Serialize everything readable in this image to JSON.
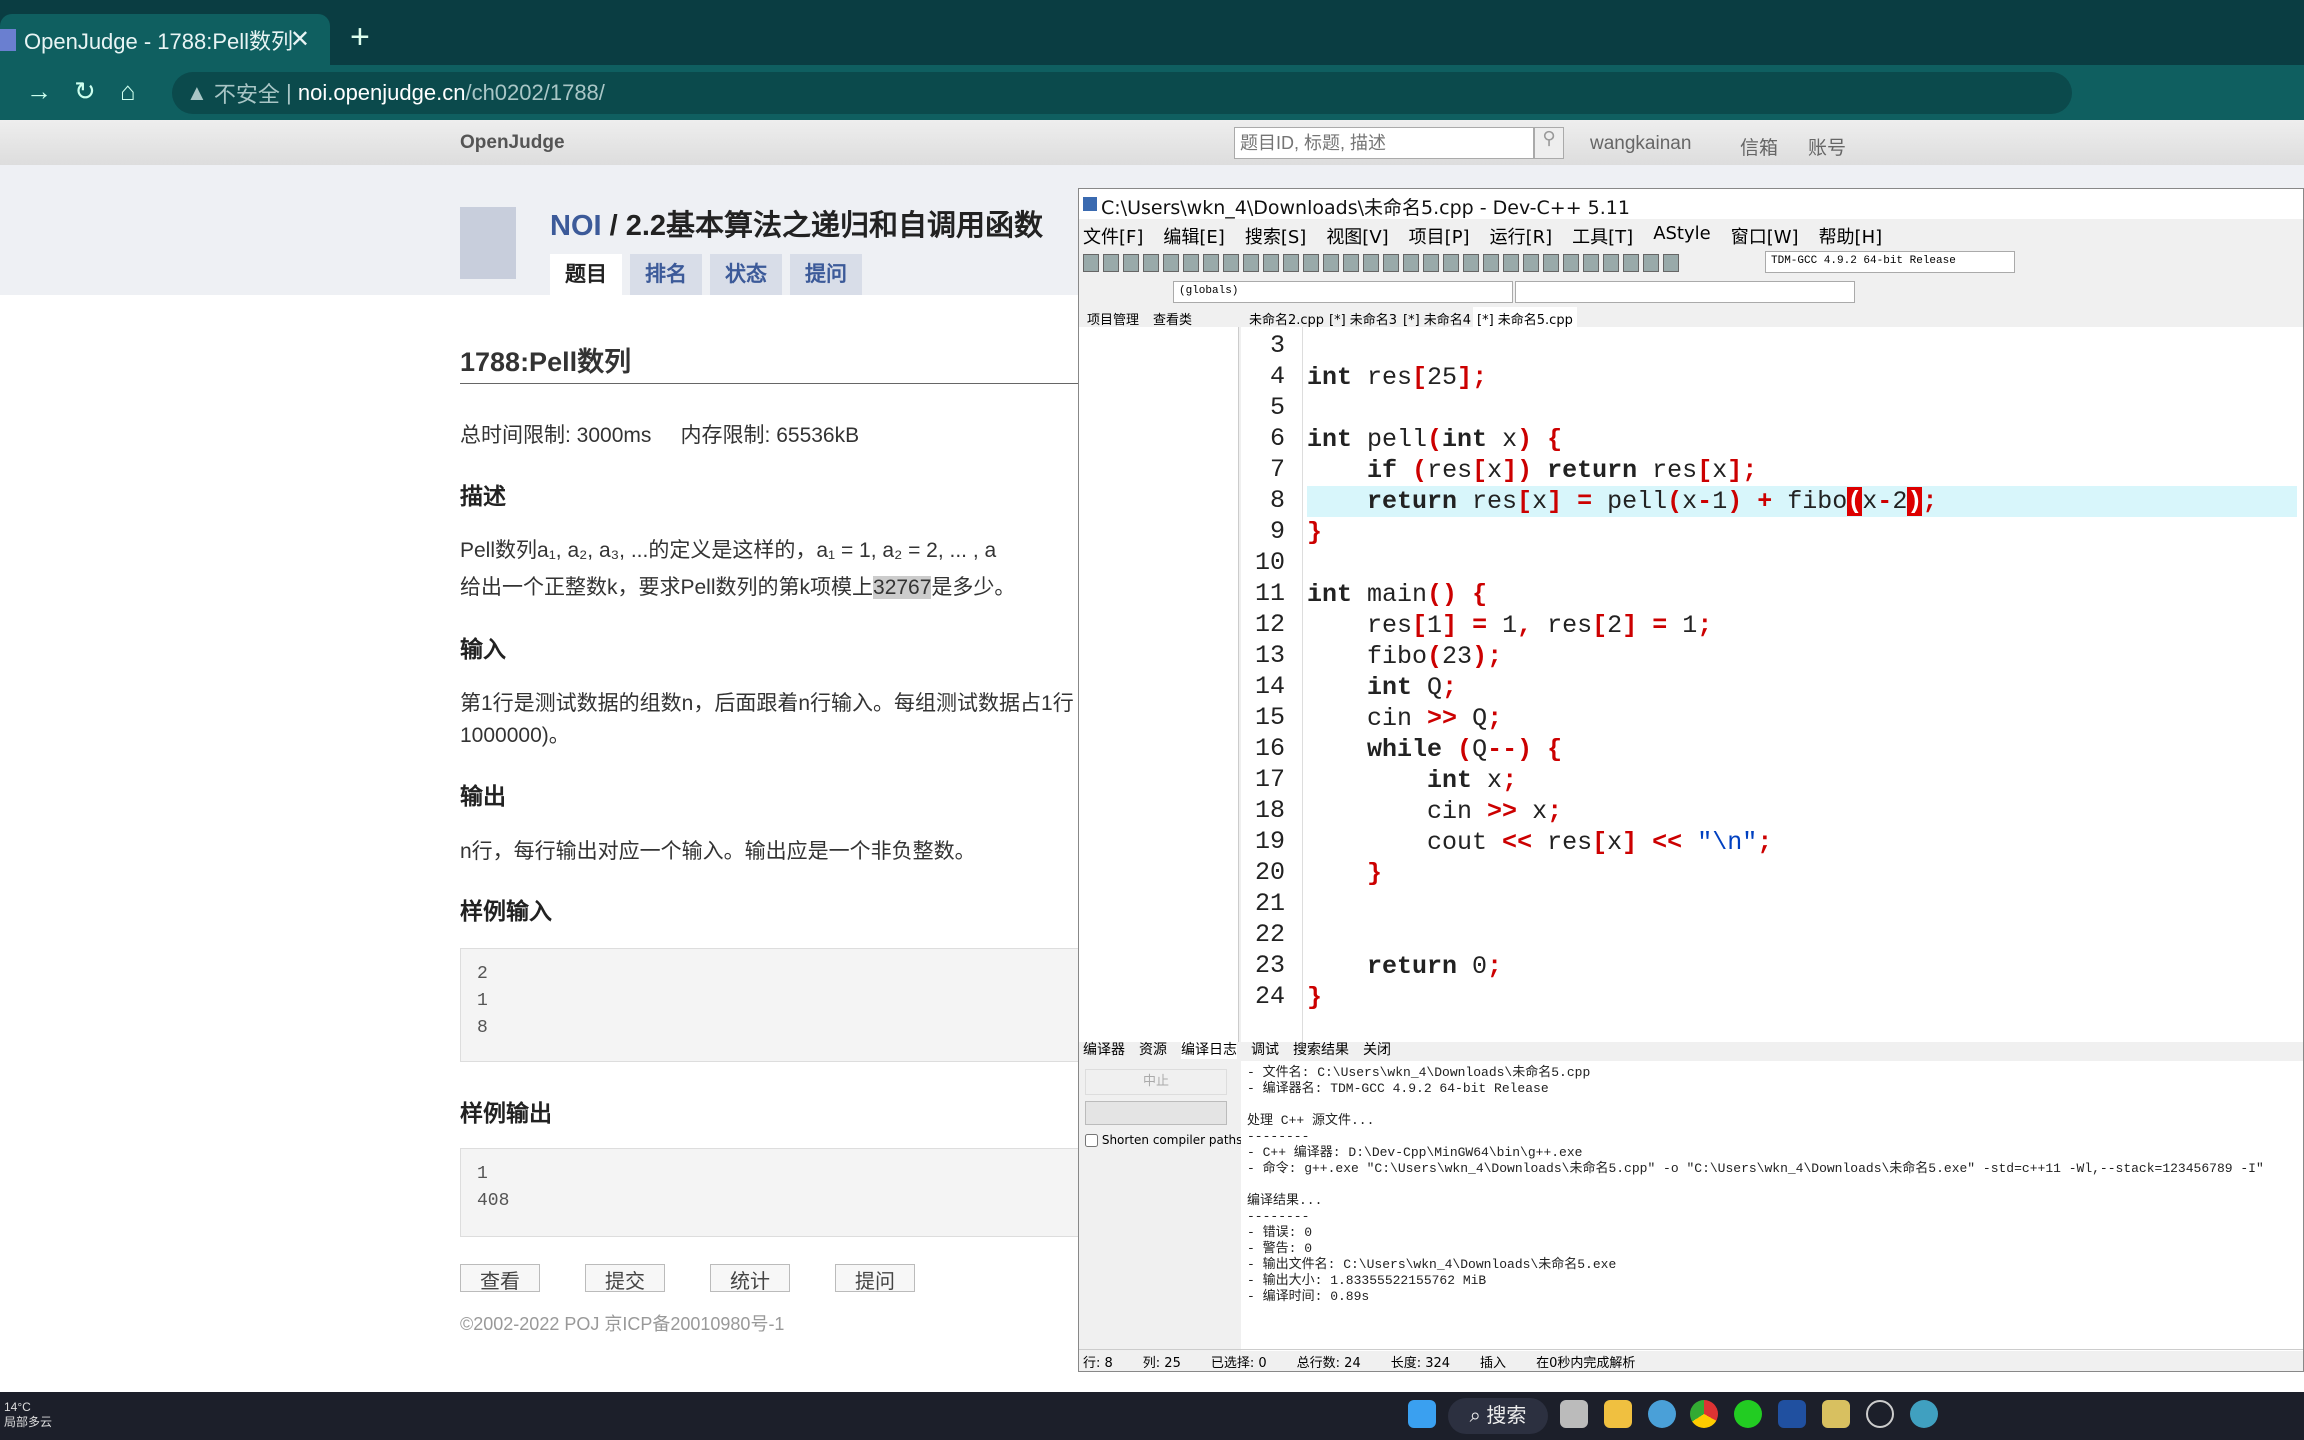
{
  "browser": {
    "tab_title": "OpenJudge - 1788:Pell数列",
    "favicon": "OJ",
    "insecure": "不安全",
    "url_host": "noi.openjudge.cn",
    "url_path": "/ch0202/1788/"
  },
  "oj": {
    "brand": "OpenJudge",
    "search_placeholder": "题目ID, 标题, 描述",
    "user": "wangkainan",
    "mail": "信箱",
    "account": "账号",
    "crumb_root": "NOI",
    "crumb_sep": " / ",
    "crumb_title": "2.2基本算法之递归和自调用函数",
    "tabs": [
      "题目",
      "排名",
      "状态",
      "提问"
    ],
    "problem_title": "1788:Pell数列",
    "limits": "总时间限制: 3000ms     内存限制: 65536kB",
    "desc_h": "描述",
    "desc1": "Pell数列a₁, a₂, a₃, ...的定义是这样的，a₁ = 1, a₂ = 2, ... , a",
    "desc2_a": "给出一个正整数k，要求Pell数列的第k项模上",
    "desc2_hl": "32767",
    "desc2_b": "是多少。",
    "input_h": "输入",
    "input1": "第1行是测试数据的组数n，后面跟着n行输入。每组测试数据占1行",
    "input2": "1000000)。",
    "output_h": "输出",
    "output1": "n行，每行输出对应一个输入。输出应是一个非负整数。",
    "sample_in_h": "样例输入",
    "sample_in": "2\n1\n8",
    "sample_out_h": "样例输出",
    "sample_out": "1\n408",
    "buttons": [
      "查看",
      "提交",
      "统计",
      "提问"
    ],
    "footer": "©2002-2022 POJ 京ICP备20010980号-1"
  },
  "dev": {
    "title": "C:\\Users\\wkn_4\\Downloads\\未命名5.cpp - Dev-C++ 5.11",
    "menu": [
      "文件[F]",
      "编辑[E]",
      "搜索[S]",
      "视图[V]",
      "项目[P]",
      "运行[R]",
      "工具[T]",
      "AStyle",
      "窗口[W]",
      "帮助[H]"
    ],
    "compiler": "TDM-GCC 4.9.2 64-bit Release",
    "scope": "(globals)",
    "panel_tabs": [
      "项目管理",
      "查看类"
    ],
    "file_tabs": [
      "未命名2.cpp",
      "[*] 未命名3",
      "[*] 未命名4",
      "[*] 未命名5.cpp"
    ],
    "first_line": 3,
    "current_line": 8,
    "code": [
      "",
      "int res[25];",
      "",
      "int pell(int x) {",
      "    if (res[x]) return res[x];",
      "    return res[x] = pell(x-1) + fibo(x-2);",
      "}",
      "",
      "int main() {",
      "    res[1] = 1, res[2] = 1;",
      "    fibo(23);",
      "    int Q;",
      "    cin >> Q;",
      "    while (Q--) {",
      "        int x;",
      "        cin >> x;",
      "        cout << res[x] << \"\\n\";",
      "    }",
      "",
      "",
      "    return 0;",
      "}"
    ],
    "bottom_tabs": [
      "编译器",
      "资源",
      "编译日志",
      "调试",
      "搜索结果",
      "关闭"
    ],
    "abort": "中止",
    "shorten": "Shorten compiler paths",
    "log": "- 文件名: C:\\Users\\wkn_4\\Downloads\\未命名5.cpp\n- 编译器名: TDM-GCC 4.9.2 64-bit Release\n\n处理 C++ 源文件...\n--------\n- C++ 编译器: D:\\Dev-Cpp\\MinGW64\\bin\\g++.exe\n- 命令: g++.exe \"C:\\Users\\wkn_4\\Downloads\\未命名5.cpp\" -o \"C:\\Users\\wkn_4\\Downloads\\未命名5.exe\" -std=c++11 -Wl,--stack=123456789 -I\"\n\n编译结果...\n--------\n- 错误: 0\n- 警告: 0\n- 输出文件名: C:\\Users\\wkn_4\\Downloads\\未命名5.exe\n- 输出大小: 1.83355522155762 MiB\n- 编译时间: 0.89s",
    "status": [
      "行: 8",
      "列: 25",
      "已选择: 0",
      "总行数: 24",
      "长度: 324",
      "插入",
      "在0秒内完成解析"
    ]
  },
  "taskbar": {
    "search": "搜索",
    "weather_temp": "14°C",
    "weather_desc": "局部多云"
  }
}
